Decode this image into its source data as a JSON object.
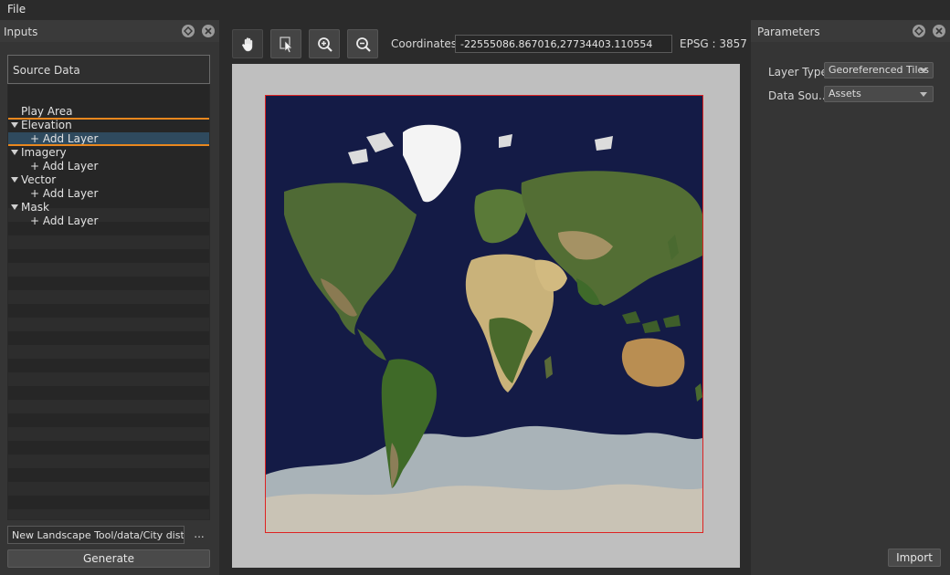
{
  "menu": {
    "file_label": "File"
  },
  "inputs_panel": {
    "title": "Inputs",
    "source_data_label": "Source Data",
    "tree": [
      {
        "label": "Play Area",
        "level": 0,
        "expandable": false
      },
      {
        "label": "Elevation",
        "level": 0,
        "expandable": true
      },
      {
        "label": "+ Add Layer",
        "level": 1,
        "expandable": false
      },
      {
        "label": "Imagery",
        "level": 0,
        "expandable": true
      },
      {
        "label": "+ Add Layer",
        "level": 1,
        "expandable": false
      },
      {
        "label": "Vector",
        "level": 0,
        "expandable": true
      },
      {
        "label": "+ Add Layer",
        "level": 1,
        "expandable": false
      },
      {
        "label": "Mask",
        "level": 0,
        "expandable": true
      },
      {
        "label": "+ Add Layer",
        "level": 1,
        "expandable": false
      }
    ],
    "path_value": "New Landscape Tool/data/City district",
    "browse_label": "...",
    "generate_label": "Generate"
  },
  "viewport_toolbar": {
    "tools": [
      {
        "name": "pan-tool",
        "icon": "hand-icon"
      },
      {
        "name": "select-tool",
        "icon": "select-cursor-icon"
      },
      {
        "name": "zoom-in-tool",
        "icon": "zoom-in-icon"
      },
      {
        "name": "zoom-out-tool",
        "icon": "zoom-out-icon"
      }
    ],
    "coordinates_label": "Coordinates:",
    "coordinates_value": "-22555086.867016,27734403.110554",
    "epsg_label": "EPSG : 3857"
  },
  "parameters_panel": {
    "title": "Parameters",
    "layer_type_label": "Layer Type",
    "layer_type_value": "Georeferenced Tiles",
    "data_source_label": "Data Sou...",
    "data_source_value": "Assets",
    "import_label": "Import"
  },
  "colors": {
    "accent_focus": "#e8871e",
    "selection": "#2f4a5e",
    "map_border": "#dd2222",
    "ocean": "#131a44"
  }
}
